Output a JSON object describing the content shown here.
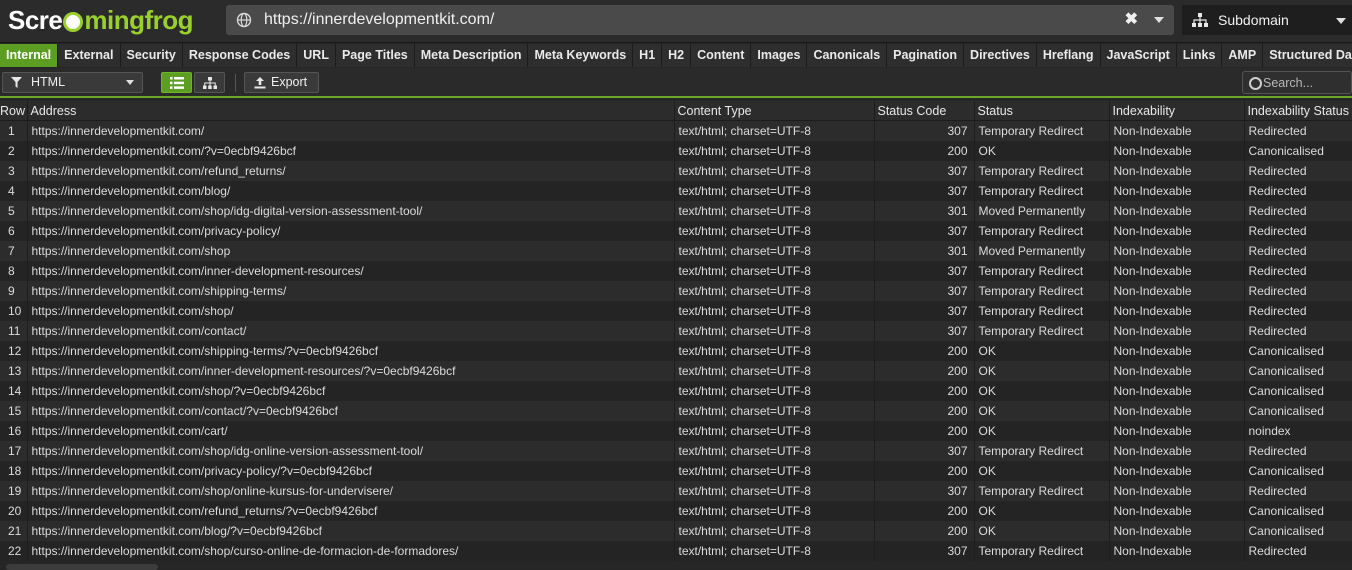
{
  "app": {
    "logo_text_a": "Scre",
    "logo_text_b": "mingfrog",
    "url": "https://innerdevelopmentkit.com/",
    "clear_symbol": "✖",
    "mode": "Subdomain"
  },
  "tabs": [
    "Internal",
    "External",
    "Security",
    "Response Codes",
    "URL",
    "Page Titles",
    "Meta Description",
    "Meta Keywords",
    "H1",
    "H2",
    "Content",
    "Images",
    "Canonicals",
    "Pagination",
    "Directives",
    "Hreflang",
    "JavaScript",
    "Links",
    "AMP",
    "Structured Data"
  ],
  "active_tab": "Internal",
  "toolbar": {
    "filter_value": "HTML",
    "export_label": "Export",
    "search_placeholder": "Search..."
  },
  "colors": {
    "accent": "#5c9e22",
    "background": "#262626"
  },
  "table": {
    "headers": [
      "Row",
      "Address",
      "Content Type",
      "Status Code",
      "Status",
      "Indexability",
      "Indexability Status"
    ],
    "rows": [
      [
        "1",
        "https://innerdevelopmentkit.com/",
        "text/html; charset=UTF-8",
        "307",
        "Temporary Redirect",
        "Non-Indexable",
        "Redirected"
      ],
      [
        "2",
        "https://innerdevelopmentkit.com/?v=0ecbf9426bcf",
        "text/html; charset=UTF-8",
        "200",
        "OK",
        "Non-Indexable",
        "Canonicalised"
      ],
      [
        "3",
        "https://innerdevelopmentkit.com/refund_returns/",
        "text/html; charset=UTF-8",
        "307",
        "Temporary Redirect",
        "Non-Indexable",
        "Redirected"
      ],
      [
        "4",
        "https://innerdevelopmentkit.com/blog/",
        "text/html; charset=UTF-8",
        "307",
        "Temporary Redirect",
        "Non-Indexable",
        "Redirected"
      ],
      [
        "5",
        "https://innerdevelopmentkit.com/shop/idg-digital-version-assessment-tool/",
        "text/html; charset=UTF-8",
        "301",
        "Moved Permanently",
        "Non-Indexable",
        "Redirected"
      ],
      [
        "6",
        "https://innerdevelopmentkit.com/privacy-policy/",
        "text/html; charset=UTF-8",
        "307",
        "Temporary Redirect",
        "Non-Indexable",
        "Redirected"
      ],
      [
        "7",
        "https://innerdevelopmentkit.com/shop",
        "text/html; charset=UTF-8",
        "301",
        "Moved Permanently",
        "Non-Indexable",
        "Redirected"
      ],
      [
        "8",
        "https://innerdevelopmentkit.com/inner-development-resources/",
        "text/html; charset=UTF-8",
        "307",
        "Temporary Redirect",
        "Non-Indexable",
        "Redirected"
      ],
      [
        "9",
        "https://innerdevelopmentkit.com/shipping-terms/",
        "text/html; charset=UTF-8",
        "307",
        "Temporary Redirect",
        "Non-Indexable",
        "Redirected"
      ],
      [
        "10",
        "https://innerdevelopmentkit.com/shop/",
        "text/html; charset=UTF-8",
        "307",
        "Temporary Redirect",
        "Non-Indexable",
        "Redirected"
      ],
      [
        "11",
        "https://innerdevelopmentkit.com/contact/",
        "text/html; charset=UTF-8",
        "307",
        "Temporary Redirect",
        "Non-Indexable",
        "Redirected"
      ],
      [
        "12",
        "https://innerdevelopmentkit.com/shipping-terms/?v=0ecbf9426bcf",
        "text/html; charset=UTF-8",
        "200",
        "OK",
        "Non-Indexable",
        "Canonicalised"
      ],
      [
        "13",
        "https://innerdevelopmentkit.com/inner-development-resources/?v=0ecbf9426bcf",
        "text/html; charset=UTF-8",
        "200",
        "OK",
        "Non-Indexable",
        "Canonicalised"
      ],
      [
        "14",
        "https://innerdevelopmentkit.com/shop/?v=0ecbf9426bcf",
        "text/html; charset=UTF-8",
        "200",
        "OK",
        "Non-Indexable",
        "Canonicalised"
      ],
      [
        "15",
        "https://innerdevelopmentkit.com/contact/?v=0ecbf9426bcf",
        "text/html; charset=UTF-8",
        "200",
        "OK",
        "Non-Indexable",
        "Canonicalised"
      ],
      [
        "16",
        "https://innerdevelopmentkit.com/cart/",
        "text/html; charset=UTF-8",
        "200",
        "OK",
        "Non-Indexable",
        "noindex"
      ],
      [
        "17",
        "https://innerdevelopmentkit.com/shop/idg-online-version-assessment-tool/",
        "text/html; charset=UTF-8",
        "307",
        "Temporary Redirect",
        "Non-Indexable",
        "Redirected"
      ],
      [
        "18",
        "https://innerdevelopmentkit.com/privacy-policy/?v=0ecbf9426bcf",
        "text/html; charset=UTF-8",
        "200",
        "OK",
        "Non-Indexable",
        "Canonicalised"
      ],
      [
        "19",
        "https://innerdevelopmentkit.com/shop/online-kursus-for-undervisere/",
        "text/html; charset=UTF-8",
        "307",
        "Temporary Redirect",
        "Non-Indexable",
        "Redirected"
      ],
      [
        "20",
        "https://innerdevelopmentkit.com/refund_returns/?v=0ecbf9426bcf",
        "text/html; charset=UTF-8",
        "200",
        "OK",
        "Non-Indexable",
        "Canonicalised"
      ],
      [
        "21",
        "https://innerdevelopmentkit.com/blog/?v=0ecbf9426bcf",
        "text/html; charset=UTF-8",
        "200",
        "OK",
        "Non-Indexable",
        "Canonicalised"
      ],
      [
        "22",
        "https://innerdevelopmentkit.com/shop/curso-online-de-formacion-de-formadores/",
        "text/html; charset=UTF-8",
        "307",
        "Temporary Redirect",
        "Non-Indexable",
        "Redirected"
      ]
    ]
  }
}
